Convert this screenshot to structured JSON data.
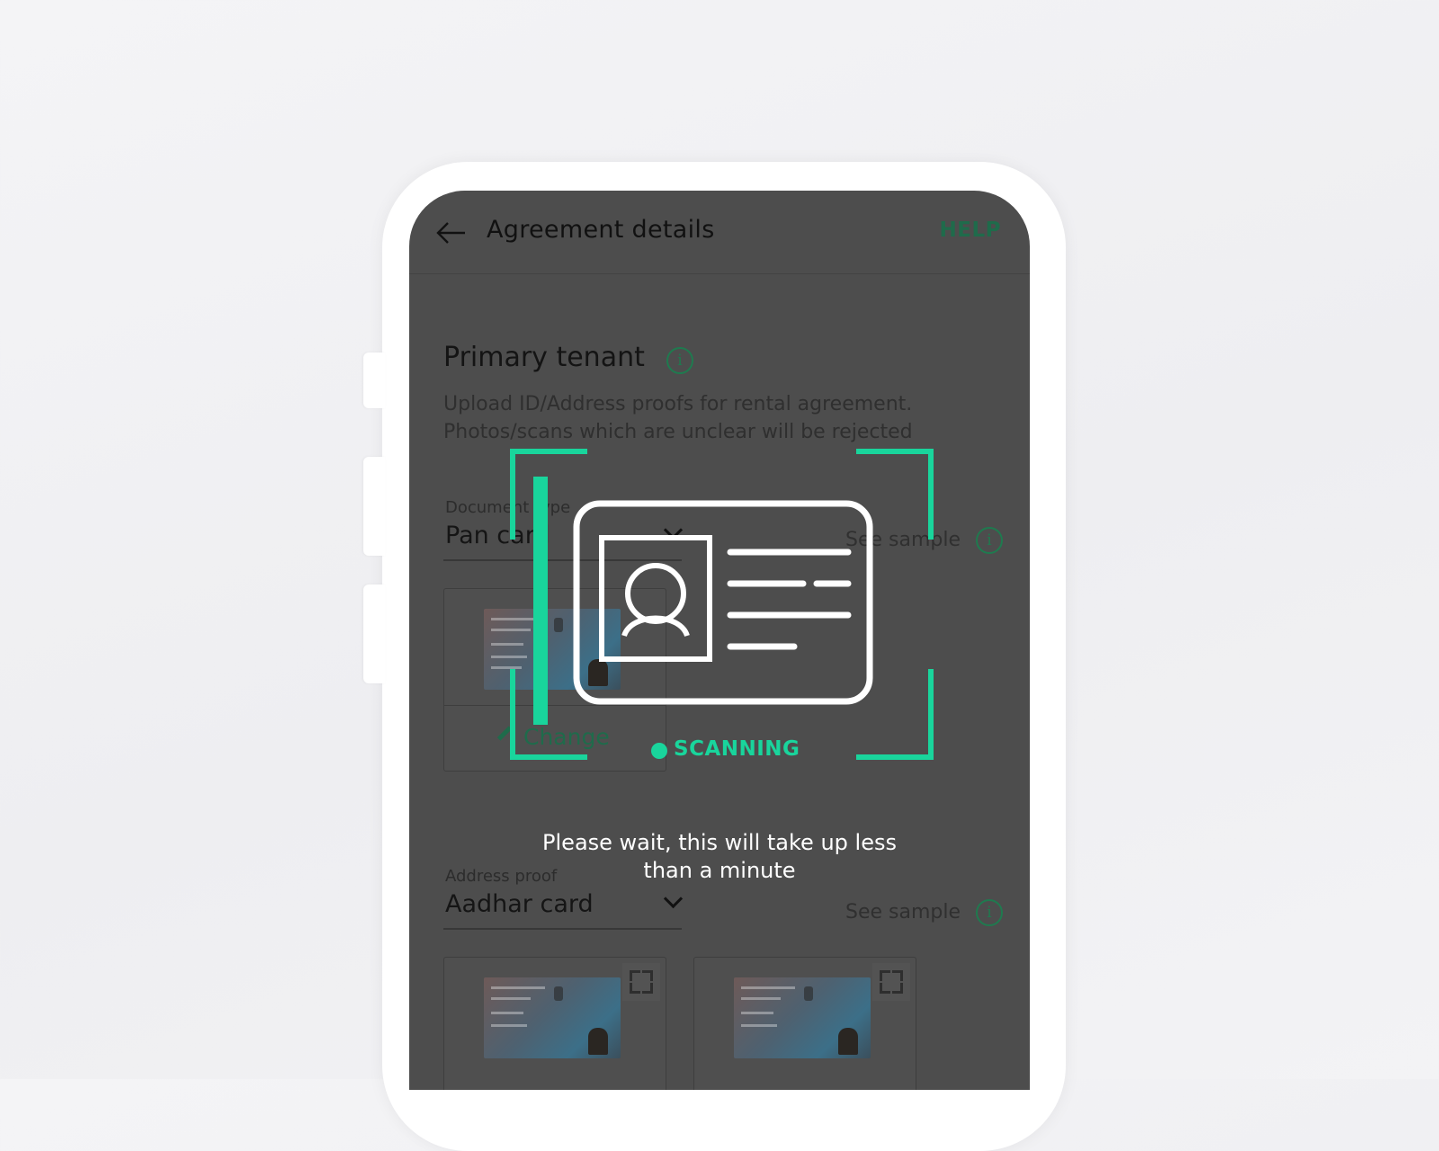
{
  "appbar": {
    "title": "Agreement details",
    "help": "HELP",
    "back_icon": "arrow-left-icon"
  },
  "tenant": {
    "heading": "Primary tenant",
    "description_line1": "Upload ID/Address proofs for rental agreement.",
    "description_line2": "Photos/scans which are unclear will be rejected",
    "info_icon": "i"
  },
  "document_type": {
    "label": "Document type",
    "value": "Pan card",
    "see_sample": "See sample",
    "change_label": "Change"
  },
  "address_proof": {
    "label": "Address proof",
    "value": "Aadhar card",
    "see_sample": "See sample"
  },
  "scanning": {
    "status": "SCANNING",
    "message_line1": "Please wait, this will take up less",
    "message_line2": "than a minute"
  },
  "colors": {
    "accent": "#19d59c",
    "dim_green": "#1f6b4b",
    "dim_overlay": "#4d4d4d",
    "white": "#ffffff"
  }
}
